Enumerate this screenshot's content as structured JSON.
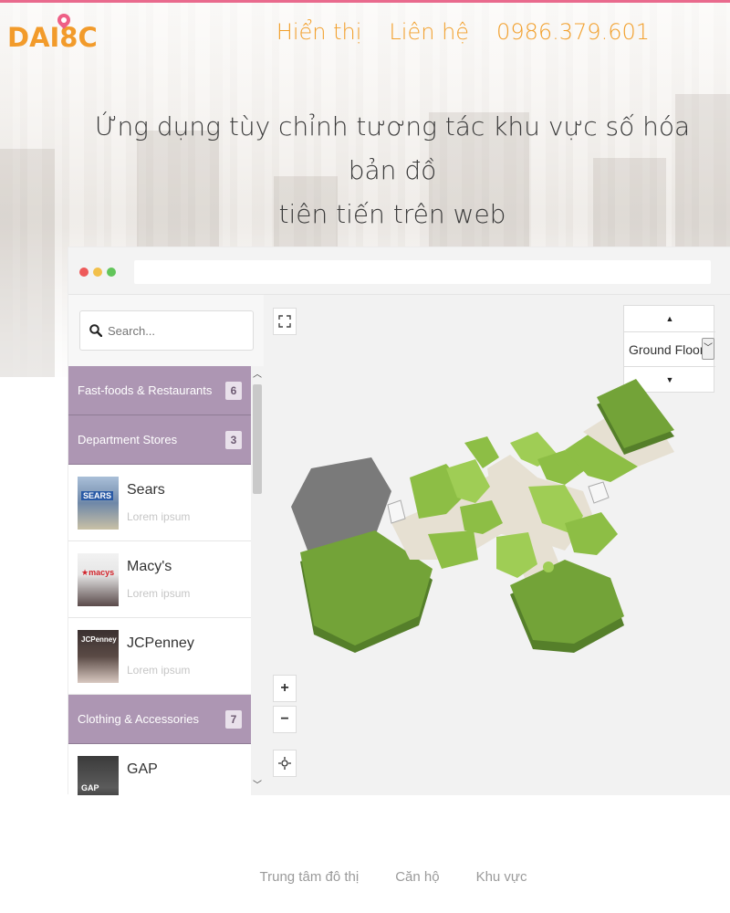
{
  "brand": {
    "logo_text": "DAI8C",
    "accent": "#f29b2b",
    "pin_color": "#ee5f86"
  },
  "nav": {
    "items": [
      "Hiển thị",
      "Liên hệ",
      "0986.379.601"
    ]
  },
  "hero": {
    "title_line1": "Ứng dụng tùy chỉnh tương tác khu vực số hóa bản đồ",
    "title_line2": "tiên tiến trên web"
  },
  "search": {
    "placeholder": "Search...",
    "value": ""
  },
  "categories": [
    {
      "label": "Fast-foods & Restaurants",
      "count": "6"
    },
    {
      "label": "Department Stores",
      "count": "3"
    },
    {
      "label": "Clothing & Accessories",
      "count": "7"
    }
  ],
  "stores": [
    {
      "name": "Sears",
      "subtitle": "Lorem ipsum",
      "sign": "SEARS"
    },
    {
      "name": "Macy's",
      "subtitle": "Lorem ipsum",
      "sign": "★macys"
    },
    {
      "name": "JCPenney",
      "subtitle": "Lorem ipsum",
      "sign": "JCPenney"
    },
    {
      "name": "GAP",
      "subtitle": "",
      "sign": "GAP"
    }
  ],
  "map": {
    "floor_selected": "Ground Floor",
    "zoom_in": "+",
    "zoom_out": "−",
    "up_arrow": "▲",
    "down_arrow": "▼",
    "colors": {
      "shop": "#8dbe45",
      "anchor": "#6a9a34",
      "corridor": "#e6e0d2",
      "anchor_gray": "#8a8a8a"
    }
  },
  "footer": {
    "links": [
      "Trung tâm đô thị",
      "Căn hộ",
      "Khu vực"
    ]
  }
}
